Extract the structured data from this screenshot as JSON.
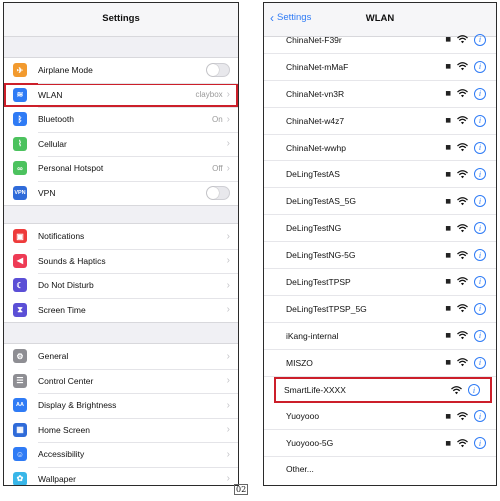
{
  "left": {
    "title": "Settings",
    "group1": [
      {
        "label": "Airplane Mode",
        "icon": "airplane-icon",
        "color": "#f29a2e",
        "control": "toggle"
      },
      {
        "label": "WLAN",
        "icon": "wifi-icon",
        "color": "#2f7bf5",
        "value": "claybox",
        "highlight": true
      },
      {
        "label": "Bluetooth",
        "icon": "bluetooth-icon",
        "color": "#2f7bf5",
        "value": "On"
      },
      {
        "label": "Cellular",
        "icon": "cellular-icon",
        "color": "#4cc25e"
      },
      {
        "label": "Personal Hotspot",
        "icon": "hotspot-icon",
        "color": "#4cc25e",
        "value": "Off"
      },
      {
        "label": "VPN",
        "icon": "vpn-icon",
        "color": "#2f6bd9",
        "control": "toggle",
        "badge": "VPN"
      }
    ],
    "group2": [
      {
        "label": "Notifications",
        "icon": "notifications-icon",
        "color": "#ee3b3b"
      },
      {
        "label": "Sounds & Haptics",
        "icon": "sounds-icon",
        "color": "#ee3b55"
      },
      {
        "label": "Do Not Disturb",
        "icon": "moon-icon",
        "color": "#5b4fd6"
      },
      {
        "label": "Screen Time",
        "icon": "hourglass-icon",
        "color": "#5b4fd6"
      }
    ],
    "group3": [
      {
        "label": "General",
        "icon": "gear-icon",
        "color": "#8e8e93"
      },
      {
        "label": "Control Center",
        "icon": "control-center-icon",
        "color": "#8e8e93"
      },
      {
        "label": "Display & Brightness",
        "icon": "display-icon",
        "color": "#2f7bf5",
        "badge": "AA"
      },
      {
        "label": "Home Screen",
        "icon": "home-screen-icon",
        "color": "#2f6bd9"
      },
      {
        "label": "Accessibility",
        "icon": "accessibility-icon",
        "color": "#2f7bf5"
      },
      {
        "label": "Wallpaper",
        "icon": "wallpaper-icon",
        "color": "#38b6e8"
      }
    ]
  },
  "right": {
    "back_label": "Settings",
    "title": "WLAN",
    "networks": [
      {
        "name": "ChinaNet-F39r",
        "locked": true
      },
      {
        "name": "ChinaNet-mMaF",
        "locked": true
      },
      {
        "name": "ChinaNet-vn3R",
        "locked": true
      },
      {
        "name": "ChinaNet-w4z7",
        "locked": true
      },
      {
        "name": "ChinaNet-wwhp",
        "locked": true
      },
      {
        "name": "DeLingTestAS",
        "locked": true
      },
      {
        "name": "DeLingTestAS_5G",
        "locked": true
      },
      {
        "name": "DeLingTestNG",
        "locked": true
      },
      {
        "name": "DeLingTestNG-5G",
        "locked": true
      },
      {
        "name": "DeLingTestTPSP",
        "locked": true
      },
      {
        "name": "DeLingTestTPSP_5G",
        "locked": true
      },
      {
        "name": "iKang-internal",
        "locked": true
      },
      {
        "name": "MISZO",
        "locked": true
      },
      {
        "name": "SmartLife-XXXX",
        "locked": false,
        "highlight": true
      },
      {
        "name": "Yuoyooo",
        "locked": true
      },
      {
        "name": "Yuoyooo-5G",
        "locked": true
      }
    ],
    "other_label": "Other..."
  },
  "page_number": "02"
}
